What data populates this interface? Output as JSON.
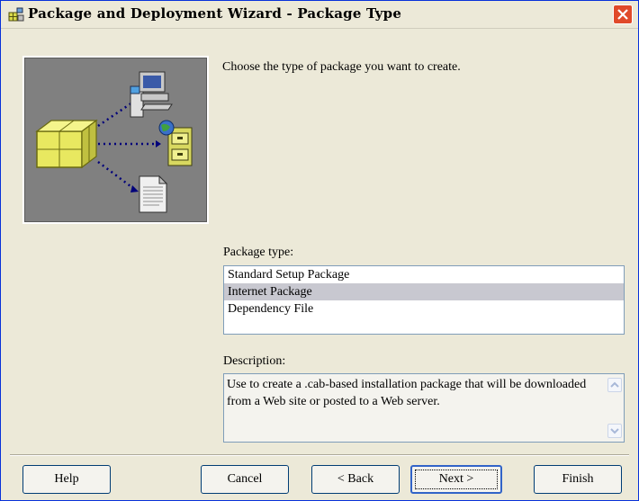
{
  "window": {
    "title": "Package and Deployment Wizard - Package Type"
  },
  "instruction": "Choose the type of package you want to create.",
  "package_type": {
    "label": "Package type:",
    "items": [
      "Standard Setup Package",
      "Internet Package",
      "Dependency File"
    ],
    "selected": "Internet Package"
  },
  "description": {
    "label": "Description:",
    "text": "Use to create a .cab-based installation package that will be downloaded from a Web site or posted to a Web server."
  },
  "buttons": {
    "help": "Help",
    "cancel": "Cancel",
    "back": "< Back",
    "next": "Next >",
    "finish": "Finish"
  },
  "colors": {
    "selection": "#c8c8d0",
    "close_button": "#e04a2a",
    "art_background": "#808080"
  }
}
